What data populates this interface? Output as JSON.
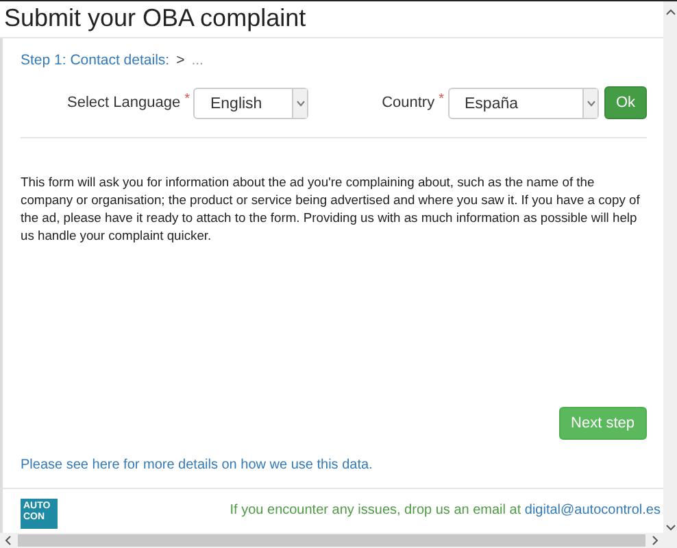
{
  "window": {
    "title": "Submit your OBA complaint"
  },
  "breadcrumb": {
    "step": "Step 1: Contact details:",
    "separator": ">",
    "next": "..."
  },
  "language": {
    "label": "Select Language",
    "required_mark": "*",
    "value": "English"
  },
  "country": {
    "label": "Country",
    "required_mark": "*",
    "value": "España"
  },
  "ok_button": "Ok",
  "intro": "This form will ask you for information about the ad you're complaining about, such as the name of the company or organisation; the product or service being advertised and where you saw it. If you have a copy of the ad, please have it ready to attach to the form. Providing us with as much information as possible will help us handle your complaint quicker.",
  "next_button": "Next step",
  "privacy_link": "Please see here for more details on how we use this data.",
  "footer": {
    "logo_lines": [
      "AUTO",
      "CON"
    ],
    "message": "If you encounter any issues, drop us an email at",
    "email": "digital@autocontrol.es"
  }
}
